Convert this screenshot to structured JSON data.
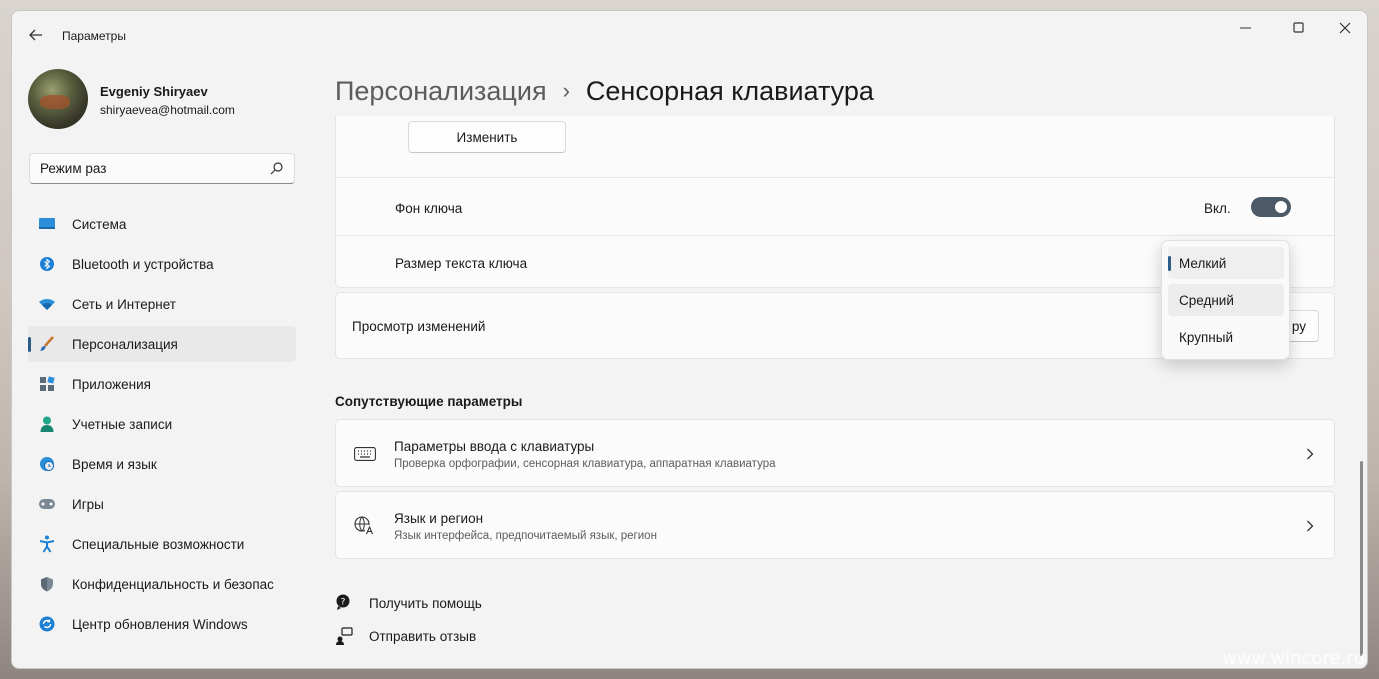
{
  "app": {
    "title": "Параметры"
  },
  "user": {
    "name": "Evgeniy Shiryaev",
    "email": "shiryaevea@hotmail.com"
  },
  "search": {
    "value": "Режим раз",
    "placeholder": ""
  },
  "sidebar": {
    "items": [
      {
        "label": "Система",
        "icon": "monitor-icon",
        "active": false
      },
      {
        "label": "Bluetooth и устройства",
        "icon": "bluetooth-icon",
        "active": false
      },
      {
        "label": "Сеть и Интернет",
        "icon": "wifi-icon",
        "active": false
      },
      {
        "label": "Персонализация",
        "icon": "brush-icon",
        "active": true
      },
      {
        "label": "Приложения",
        "icon": "apps-icon",
        "active": false
      },
      {
        "label": "Учетные записи",
        "icon": "person-icon",
        "active": false
      },
      {
        "label": "Время и язык",
        "icon": "clock-globe-icon",
        "active": false
      },
      {
        "label": "Игры",
        "icon": "gamepad-icon",
        "active": false
      },
      {
        "label": "Специальные возможности",
        "icon": "accessibility-icon",
        "active": false
      },
      {
        "label": "Конфиденциальность и безопас",
        "icon": "shield-icon",
        "active": false
      },
      {
        "label": "Центр обновления Windows",
        "icon": "update-icon",
        "active": false
      }
    ]
  },
  "breadcrumb": {
    "parent": "Персонализация",
    "separator": "›",
    "current": "Сенсорная клавиатура"
  },
  "settings": {
    "change_button": "Изменить",
    "key_background": {
      "label": "Фон ключа",
      "state": "Вкл.",
      "on": true
    },
    "key_text_size": {
      "label": "Размер текста ключа"
    },
    "preview": {
      "label": "Просмотр изменений",
      "button_partial": "ру"
    }
  },
  "dropdown": {
    "options": [
      "Мелкий",
      "Средний",
      "Крупный"
    ],
    "selected": "Мелкий",
    "hovered": "Средний"
  },
  "related": {
    "title": "Сопутствующие параметры",
    "items": [
      {
        "title": "Параметры ввода с клавиатуры",
        "subtitle": "Проверка орфографии, сенсорная клавиатура, аппаратная клавиатура",
        "icon": "keyboard-icon"
      },
      {
        "title": "Язык и регион",
        "subtitle": "Язык интерфейса, предпочитаемый язык, регион",
        "icon": "language-icon"
      }
    ]
  },
  "help": {
    "get_help": "Получить помощь",
    "feedback": "Отправить отзыв"
  },
  "watermark": "www.wincore.ru",
  "colors": {
    "accent": "#2b5d86",
    "toggle_on": "#4b5a66",
    "window_bg": "#f3f3f3",
    "card_bg": "#fbfbfb"
  }
}
